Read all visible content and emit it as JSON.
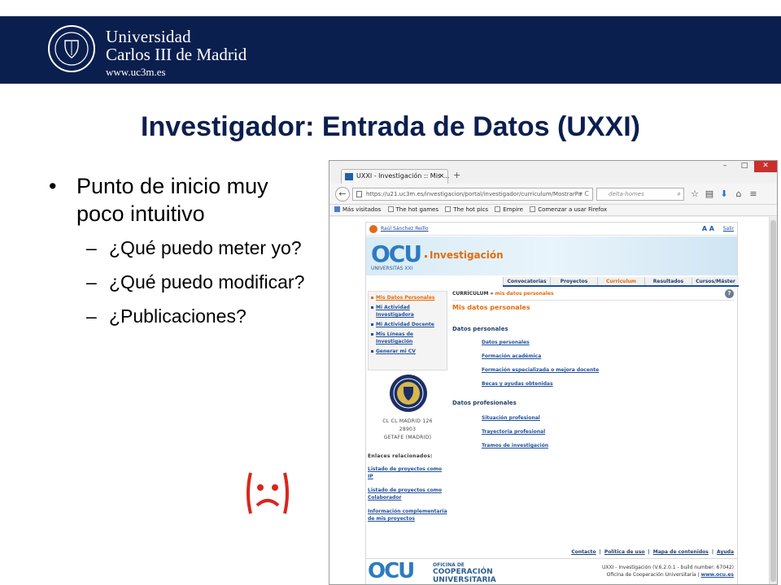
{
  "header": {
    "university_line1": "Universidad",
    "university_line2": "Carlos III de Madrid",
    "website": "www.uc3m.es"
  },
  "slide": {
    "title": "Investigador: Entrada de Datos (UXXI)",
    "bullet_main": "Punto de inicio muy poco intuitivo",
    "sub_bullets": [
      "¿Qué puedo meter yo?",
      "¿Qué puedo modificar?",
      "¿Publicaciones?"
    ],
    "emoticon": "sad-face"
  },
  "browser": {
    "tab_title": "UXXI - Investigación :: Mis ...",
    "url": "https://u21.uc3m.es/investigacion/portal/investigador/curriculum/MostrarPa",
    "search_placeholder": "delta-homes",
    "bookmarks": [
      "Más visitados",
      "The hot games",
      "The hot pics",
      "Empire",
      "Comenzar a usar Firefox"
    ]
  },
  "site": {
    "user_name": "Raúl Sánchez Reíllo",
    "salir": "Salir",
    "brand_sub": "UNIVERSITAS XXI",
    "brand_title": "Investigación",
    "top_nav": [
      "Convocatorias",
      "Proyectos",
      "Curriculum",
      "Resultados",
      "Cursos/Máster"
    ],
    "top_nav_active": 2,
    "left_menu": [
      "Mis Datos Personales",
      "Mi Actividad Investigadora",
      "Mi Actividad Docente",
      "Mis Líneas de Investigación",
      "Generar mi CV"
    ],
    "address_lines": [
      "CL CL MADRID 126",
      "28903",
      "GETAFE (MADRID)"
    ],
    "enlaces_title": "Enlaces relacionados:",
    "enlaces": [
      "Listado de proyectos como IP",
      "Listado de proyectos como Colaborador",
      "Información complementaria de mis proyectos"
    ],
    "breadcrumb_root": "CURRÍCULUM",
    "breadcrumb_current": "mis datos personales",
    "page_heading": "Mis datos personales",
    "section1": "Datos personales",
    "section1_links": [
      "Datos personales",
      "Formación académica",
      "Formación especializada o mejora docente",
      "Becas y ayudas obtenidas"
    ],
    "section2": "Datos profesionales",
    "section2_links": [
      "Situación profesional",
      "Trayectoria profesional",
      "Tramos de investigación"
    ],
    "footer_links": [
      "Contacto",
      "Política de uso",
      "Mapa de contenidos",
      "Ayuda"
    ],
    "footer_org_line1": "OFICINA DE",
    "footer_org_line2": "COOPERACIÓN",
    "footer_org_line3": "UNIVERSITARIA",
    "version_text": "UXXI - Investigación (V.6.2.0.1 - build number: 67042)",
    "office_text": "Oficina de Cooperación Universitaria |",
    "office_url": "www.ocu.es"
  },
  "colors": {
    "brand_navy": "#0b1f4f",
    "link_blue": "#1f4f9a",
    "accent_orange": "#e36c0a"
  }
}
